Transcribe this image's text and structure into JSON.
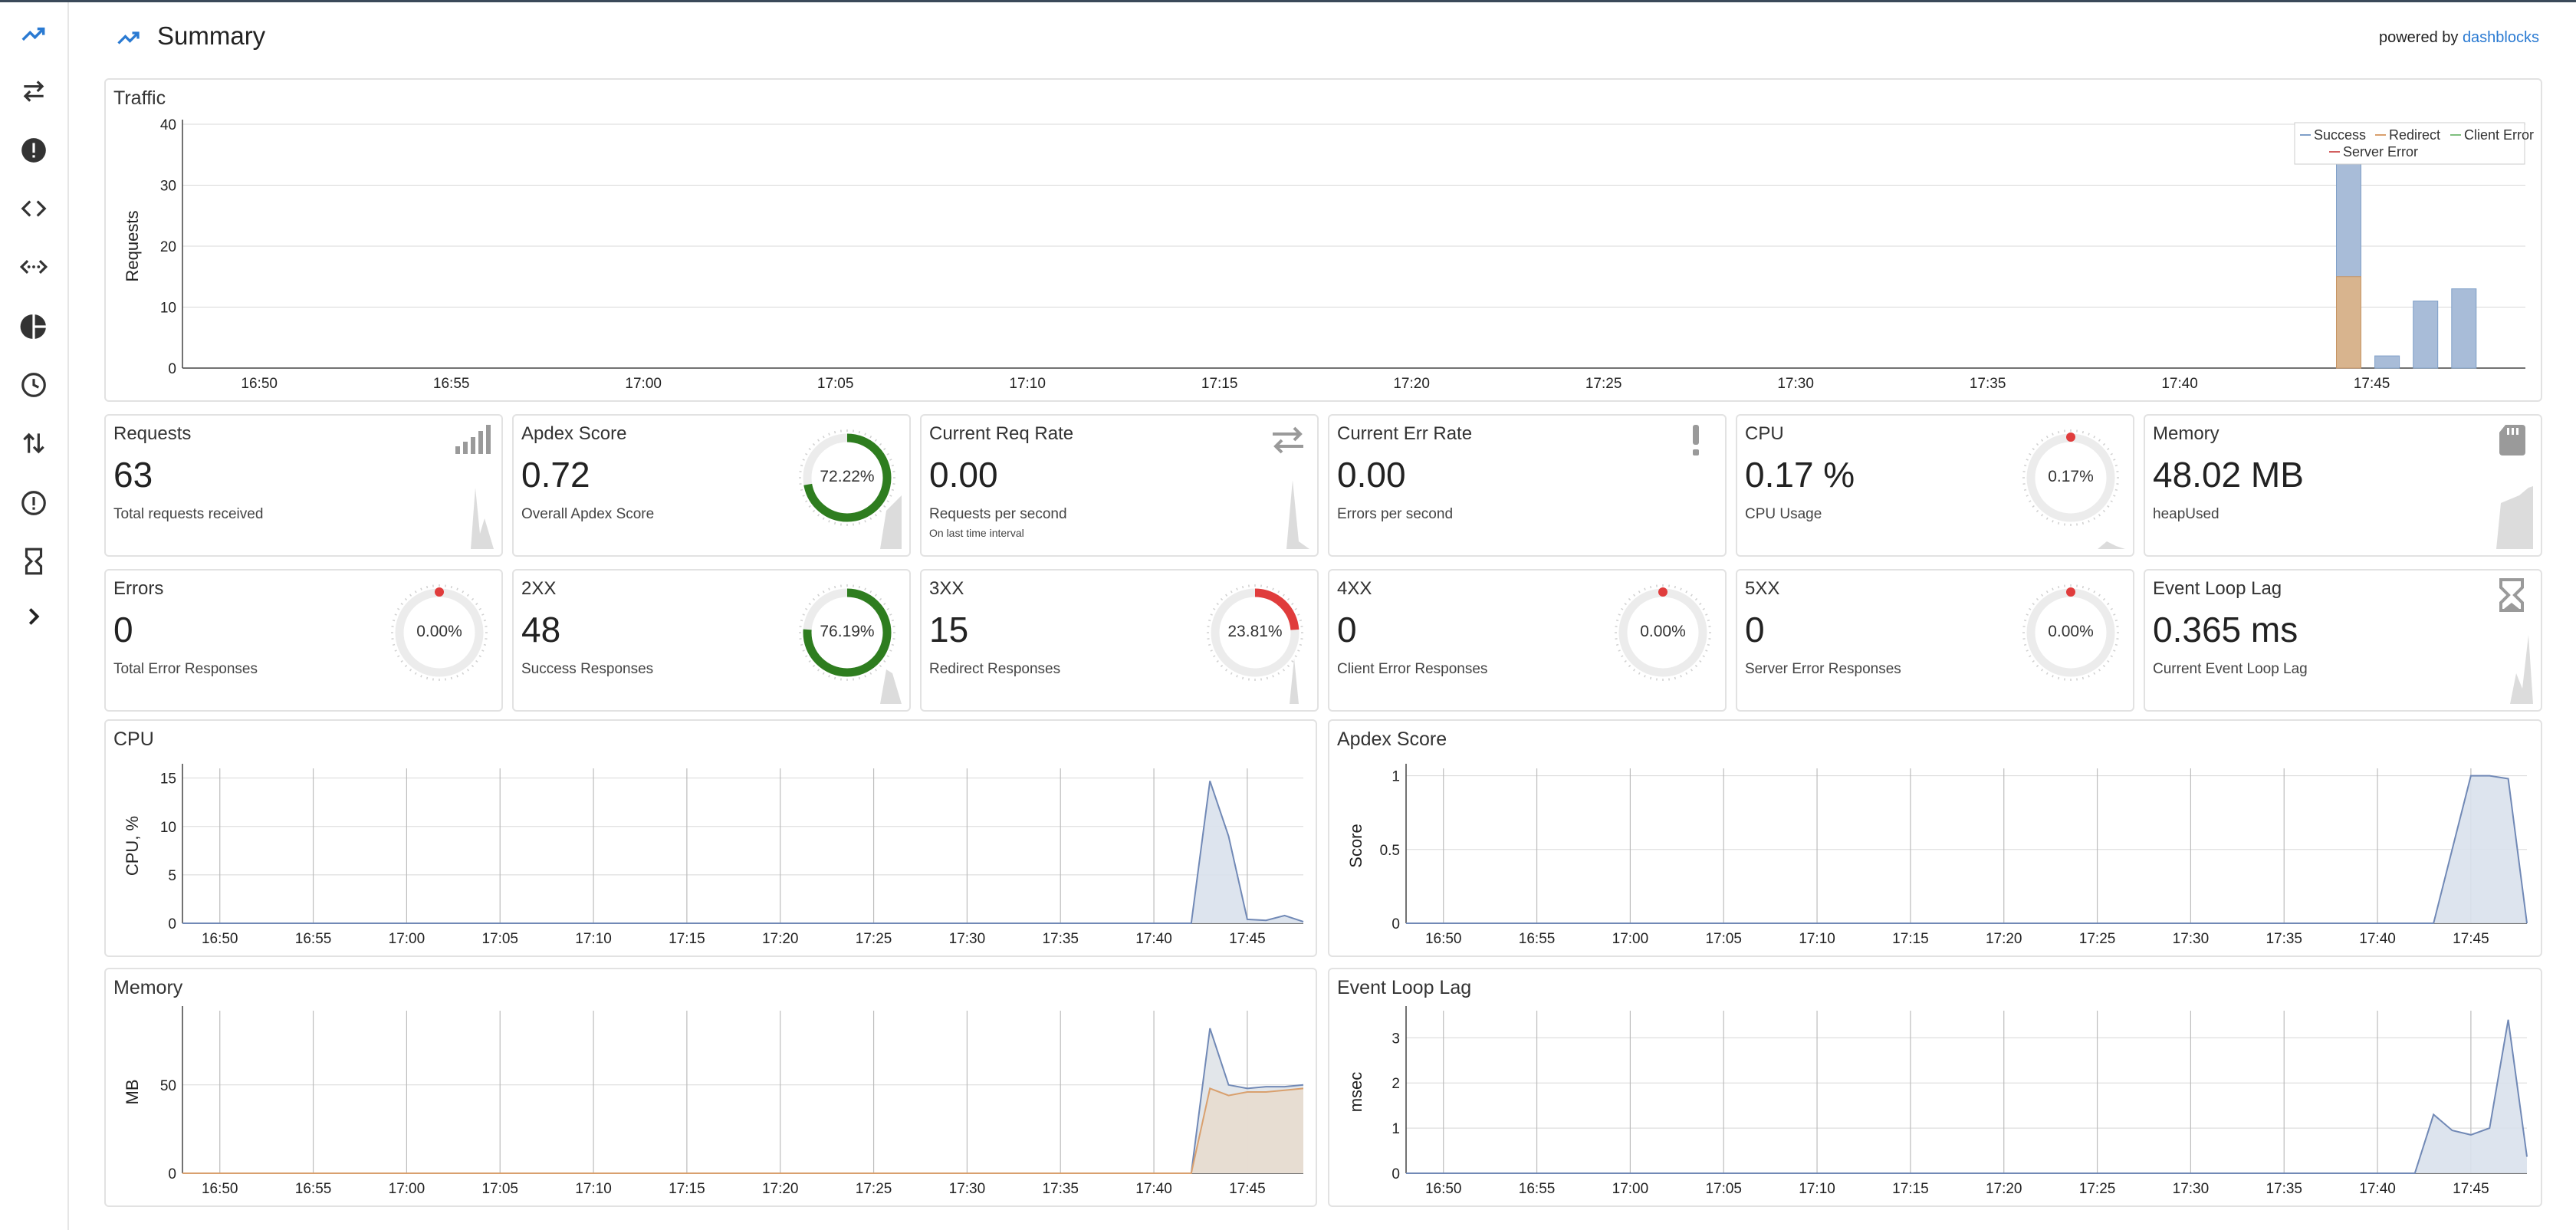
{
  "header": {
    "title": "Summary",
    "powered_by": "powered by ",
    "brand": "dashblocks"
  },
  "colors": {
    "success": "#7f9fc8",
    "redirect": "#d9a06e",
    "client_error": "#7fbf7f",
    "server_error": "#d25f5f",
    "gauge_green": "#2e7d1f",
    "gauge_red": "#e03c3c",
    "grid": "#d8d8d8"
  },
  "sidebar": {
    "items": [
      {
        "icon": "trending-up-icon"
      },
      {
        "icon": "swap-horiz-icon"
      },
      {
        "icon": "alert-circle-filled-icon"
      },
      {
        "icon": "code-icon"
      },
      {
        "icon": "settings-ethernet-icon"
      },
      {
        "icon": "pie-chart-icon"
      },
      {
        "icon": "clock-icon"
      },
      {
        "icon": "import-export-icon"
      },
      {
        "icon": "alert-circle-outline-icon"
      },
      {
        "icon": "hourglass-icon"
      },
      {
        "icon": "chevron-right-icon"
      }
    ]
  },
  "stats": [
    {
      "title": "Requests",
      "value": "63",
      "desc": "Total requests received",
      "sub": "",
      "icon": "signal-bars-icon"
    },
    {
      "title": "Apdex Score",
      "value": "0.72",
      "desc": "Overall Apdex Score",
      "sub": "",
      "gauge": "72.22%",
      "gauge_value": 0.7222,
      "gauge_color": "green"
    },
    {
      "title": "Current Req Rate",
      "value": "0.00",
      "desc": "Requests per second",
      "sub": "On last time interval",
      "icon": "swap-horiz-icon"
    },
    {
      "title": "Current Err Rate",
      "value": "0.00",
      "desc": "Errors per second",
      "sub": "",
      "icon": "exclamation-icon"
    },
    {
      "title": "CPU",
      "value": "0.17 %",
      "desc": "CPU Usage",
      "sub": "",
      "gauge": "0.17%",
      "gauge_value": 0.0017,
      "gauge_color": "red"
    },
    {
      "title": "Memory",
      "value": "48.02 MB",
      "desc": "heapUsed",
      "sub": "",
      "icon": "sd-card-icon"
    },
    {
      "title": "Errors",
      "value": "0",
      "desc": "Total Error Responses",
      "sub": "",
      "gauge": "0.00%",
      "gauge_value": 0,
      "gauge_color": "red"
    },
    {
      "title": "2XX",
      "value": "48",
      "desc": "Success Responses",
      "sub": "",
      "gauge": "76.19%",
      "gauge_value": 0.7619,
      "gauge_color": "green"
    },
    {
      "title": "3XX",
      "value": "15",
      "desc": "Redirect Responses",
      "sub": "",
      "gauge": "23.81%",
      "gauge_value": 0.2381,
      "gauge_color": "red"
    },
    {
      "title": "4XX",
      "value": "0",
      "desc": "Client Error Responses",
      "sub": "",
      "gauge": "0.00%",
      "gauge_value": 0,
      "gauge_color": "red"
    },
    {
      "title": "5XX",
      "value": "0",
      "desc": "Server Error Responses",
      "sub": "",
      "gauge": "0.00%",
      "gauge_value": 0,
      "gauge_color": "red"
    },
    {
      "title": "Event Loop Lag",
      "value": "0.365 ms",
      "desc": "Current Event Loop Lag",
      "sub": "",
      "icon": "hourglass-icon"
    }
  ],
  "chart_data": [
    {
      "id": "traffic",
      "type": "bar",
      "title": "Traffic",
      "ylabel": "Requests",
      "ylim": [
        0,
        40
      ],
      "yticks": [
        0,
        10,
        20,
        30,
        40
      ],
      "xticks": [
        "16:50",
        "16:55",
        "17:00",
        "17:05",
        "17:10",
        "17:15",
        "17:20",
        "17:25",
        "17:30",
        "17:35",
        "17:40",
        "17:45"
      ],
      "legend": [
        "Success",
        "Redirect",
        "Client Error",
        "Server Error"
      ],
      "legend_position": "top-right",
      "bars": [
        {
          "x": "17:44",
          "success": 34,
          "redirect": 15,
          "client_error": 0,
          "server_error": 0
        },
        {
          "x": "17:45",
          "success": 2,
          "redirect": 0,
          "client_error": 0,
          "server_error": 0
        },
        {
          "x": "17:46",
          "success": 11,
          "redirect": 0,
          "client_error": 0,
          "server_error": 0
        },
        {
          "x": "17:47",
          "success": 13,
          "redirect": 0,
          "client_error": 0,
          "server_error": 0
        }
      ]
    },
    {
      "id": "cpu",
      "type": "area",
      "title": "CPU",
      "ylabel": "CPU, %",
      "ylim": [
        0,
        16
      ],
      "yticks": [
        0,
        5,
        10,
        15
      ],
      "xticks": [
        "16:50",
        "16:55",
        "17:00",
        "17:05",
        "17:10",
        "17:15",
        "17:20",
        "17:25",
        "17:30",
        "17:35",
        "17:40",
        "17:45"
      ],
      "series": [
        {
          "values_x": [
            "16:48",
            "17:42",
            "17:43",
            "17:44",
            "17:45",
            "17:46",
            "17:47",
            "17:48"
          ],
          "values": [
            0,
            0,
            14.7,
            9,
            0.4,
            0.3,
            0.8,
            0.17
          ]
        }
      ]
    },
    {
      "id": "apdex",
      "type": "area",
      "title": "Apdex Score",
      "ylabel": "Score",
      "ylim": [
        0,
        1.05
      ],
      "yticks": [
        0,
        0.5,
        1
      ],
      "xticks": [
        "16:50",
        "16:55",
        "17:00",
        "17:05",
        "17:10",
        "17:15",
        "17:20",
        "17:25",
        "17:30",
        "17:35",
        "17:40",
        "17:45"
      ],
      "series": [
        {
          "values_x": [
            "16:48",
            "17:43",
            "17:44",
            "17:45",
            "17:46",
            "17:47",
            "17:48"
          ],
          "values": [
            0,
            0,
            0.5,
            1,
            1,
            0.98,
            0
          ]
        }
      ]
    },
    {
      "id": "memory",
      "type": "area",
      "title": "Memory",
      "ylabel": "MB",
      "ylim": [
        0,
        92
      ],
      "yticks": [
        0,
        50
      ],
      "xticks": [
        "16:50",
        "16:55",
        "17:00",
        "17:05",
        "17:10",
        "17:15",
        "17:20",
        "17:25",
        "17:30",
        "17:35",
        "17:40",
        "17:45"
      ],
      "series": [
        {
          "values_x": [
            "16:48",
            "17:42",
            "17:43",
            "17:44",
            "17:45",
            "17:46",
            "17:47",
            "17:48"
          ],
          "values": [
            0,
            0,
            82,
            50,
            48,
            49,
            49,
            50
          ]
        },
        {
          "values_x": [
            "16:48",
            "17:42",
            "17:43",
            "17:44",
            "17:45",
            "17:46",
            "17:47",
            "17:48"
          ],
          "values": [
            0,
            0,
            48,
            44,
            46,
            46,
            47,
            48
          ]
        }
      ]
    },
    {
      "id": "eventloop",
      "type": "area",
      "title": "Event Loop Lag",
      "ylabel": "msec",
      "ylim": [
        0,
        3.6
      ],
      "yticks": [
        0,
        1,
        2,
        3
      ],
      "xticks": [
        "16:50",
        "16:55",
        "17:00",
        "17:05",
        "17:10",
        "17:15",
        "17:20",
        "17:25",
        "17:30",
        "17:35",
        "17:40",
        "17:45"
      ],
      "series": [
        {
          "values_x": [
            "16:48",
            "17:42",
            "17:43",
            "17:44",
            "17:45",
            "17:46",
            "17:47",
            "17:48"
          ],
          "values": [
            0,
            0,
            1.3,
            0.95,
            0.85,
            1.0,
            3.4,
            0.365
          ]
        }
      ]
    }
  ]
}
